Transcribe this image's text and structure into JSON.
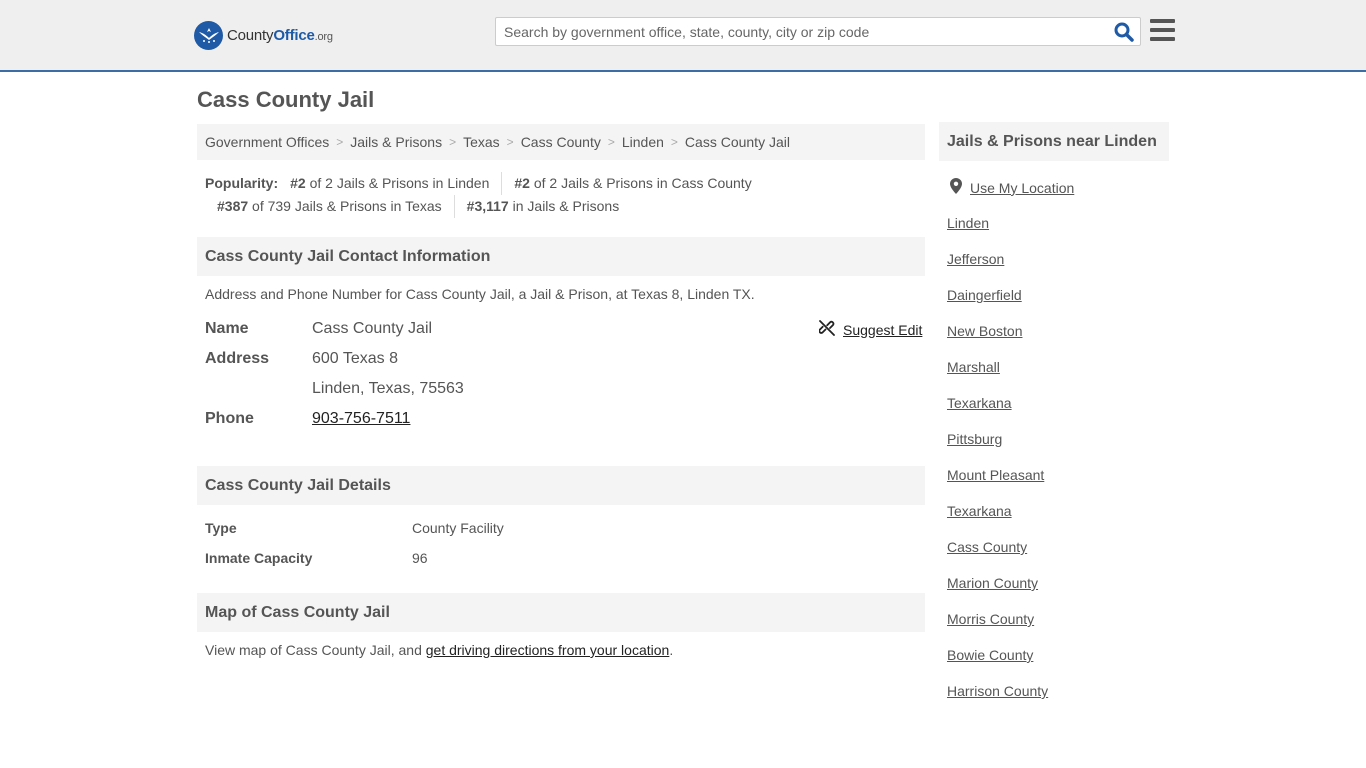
{
  "header": {
    "logo": {
      "part1": "County",
      "part2": "Office",
      "tld": ".org"
    },
    "search": {
      "placeholder": "Search by government office, state, county, city or zip code",
      "value": ""
    }
  },
  "page": {
    "title": "Cass County Jail"
  },
  "breadcrumb": [
    "Government Offices",
    "Jails & Prisons",
    "Texas",
    "Cass County",
    "Linden",
    "Cass County Jail"
  ],
  "popularity": {
    "label": "Popularity:",
    "items": [
      {
        "rank": "#2",
        "text": "of 2 Jails & Prisons in Linden"
      },
      {
        "rank": "#2",
        "text": "of 2 Jails & Prisons in Cass County"
      },
      {
        "rank": "#387",
        "text": "of 739 Jails & Prisons in Texas"
      },
      {
        "rank": "#3,117",
        "text": "in Jails & Prisons"
      }
    ]
  },
  "contact": {
    "heading": "Cass County Jail Contact Information",
    "description": "Address and Phone Number for Cass County Jail, a Jail & Prison, at Texas 8, Linden TX.",
    "suggest_edit": "Suggest Edit",
    "name_label": "Name",
    "name_value": "Cass County Jail",
    "address_label": "Address",
    "address_line1": "600 Texas 8",
    "address_line2": "Linden, Texas, 75563",
    "phone_label": "Phone",
    "phone_value": "903-756-7511"
  },
  "details": {
    "heading": "Cass County Jail Details",
    "type_label": "Type",
    "type_value": "County Facility",
    "capacity_label": "Inmate Capacity",
    "capacity_value": "96"
  },
  "map": {
    "heading": "Map of Cass County Jail",
    "text_before": "View map of Cass County Jail, and ",
    "link": "get driving directions from your location",
    "text_after": "."
  },
  "sidebar": {
    "heading": "Jails & Prisons near Linden",
    "use_location": "Use My Location",
    "links": [
      "Linden",
      "Jefferson",
      "Daingerfield",
      "New Boston",
      "Marshall",
      "Texarkana",
      "Pittsburg",
      "Mount Pleasant",
      "Texarkana",
      "Cass County",
      "Marion County",
      "Morris County",
      "Bowie County",
      "Harrison County"
    ]
  },
  "colors": {
    "accent": "#1f5aa6",
    "header_border": "#3a6ea5",
    "header_bg": "#efefef",
    "section_bg": "#f4f4f4"
  },
  "icons": [
    "seal-icon",
    "search-icon",
    "hamburger-menu-icon",
    "broken-link-icon",
    "map-pin-icon"
  ]
}
